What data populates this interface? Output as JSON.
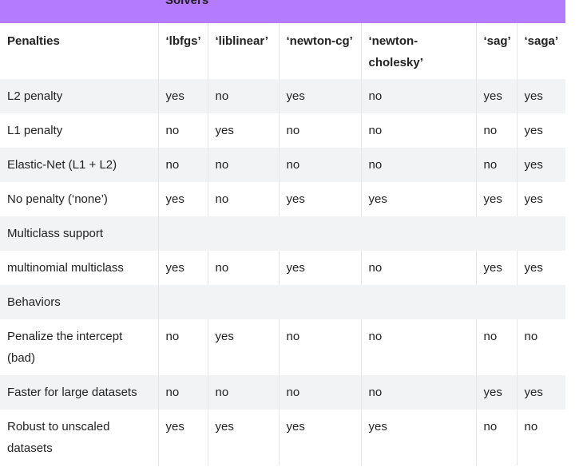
{
  "table": {
    "group_header": "Solvers",
    "first_column_header": "Penalties",
    "solver_columns": [
      "‘lbfgs’",
      "‘liblinear’",
      "‘newton-cg’",
      "‘newton-cholesky’",
      "‘sag’",
      "‘saga’"
    ],
    "rows": [
      {
        "type": "data",
        "label": "L2 penalty",
        "values": [
          "yes",
          "no",
          "yes",
          "no",
          "yes",
          "yes"
        ]
      },
      {
        "type": "data",
        "label": "L1 penalty",
        "values": [
          "no",
          "yes",
          "no",
          "no",
          "no",
          "yes"
        ]
      },
      {
        "type": "data",
        "label": "Elastic-Net (L1 + L2)",
        "values": [
          "no",
          "no",
          "no",
          "no",
          "no",
          "yes"
        ]
      },
      {
        "type": "data",
        "label": "No penalty (‘none’)",
        "values": [
          "yes",
          "no",
          "yes",
          "yes",
          "yes",
          "yes"
        ]
      },
      {
        "type": "section",
        "label": "Multiclass support"
      },
      {
        "type": "data",
        "label": "multinomial multiclass",
        "values": [
          "yes",
          "no",
          "yes",
          "no",
          "yes",
          "yes"
        ]
      },
      {
        "type": "section",
        "label": "Behaviors"
      },
      {
        "type": "data",
        "label": "Penalize the intercept (bad)",
        "values": [
          "no",
          "yes",
          "no",
          "no",
          "no",
          "no"
        ]
      },
      {
        "type": "data",
        "label": "Faster for large datasets",
        "values": [
          "no",
          "no",
          "no",
          "no",
          "yes",
          "yes"
        ]
      },
      {
        "type": "data",
        "label": "Robust to unscaled datasets",
        "values": [
          "yes",
          "yes",
          "yes",
          "yes",
          "no",
          "no"
        ]
      }
    ]
  }
}
